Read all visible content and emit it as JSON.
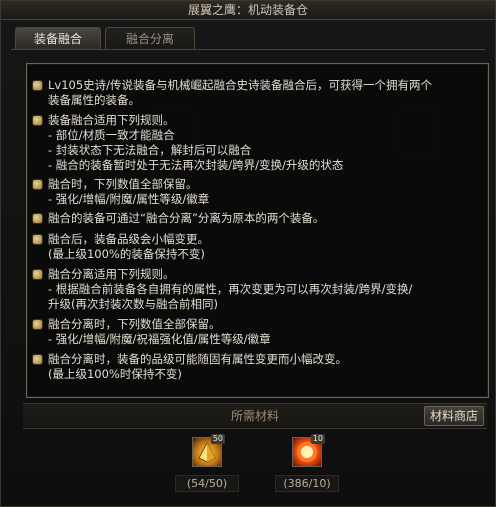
{
  "window": {
    "title": "展翼之鹰：机动装备仓"
  },
  "tabs": [
    {
      "label": "装备融合",
      "active": true
    },
    {
      "label": "融合分离",
      "active": false
    }
  ],
  "tooltip": {
    "items": [
      {
        "lines": [
          "Lv105史诗/传说装备与机械崛起融合史诗装备融合后，可获得一个拥有两个",
          "装备属性的装备。"
        ]
      },
      {
        "lines": [
          "装备融合适用下列规则。",
          "- 部位/材质一致才能融合",
          "- 封装状态下无法融合，解封后可以融合",
          "- 融合的装备暂时处于无法再次封装/跨界/变换/升级的状态"
        ]
      },
      {
        "lines": [
          "融合时，下列数值全部保留。",
          "- 强化/增幅/附魔/属性等级/徽章"
        ]
      },
      {
        "lines": [
          "融合的装备可通过“融合分离”分离为原本的两个装备。"
        ]
      },
      {
        "lines": [
          "融合后，装备品级会小幅变更。",
          "(最上级100%的装备保持不变)"
        ]
      },
      {
        "lines": [
          "融合分离适用下列规则。",
          "- 根据融合前装备各自拥有的属性，再次变更为可以再次封装/跨界/变换/",
          "升级(再次封装次数与融合前相同)"
        ]
      },
      {
        "lines": [
          "融合分离时，下列数值全部保留。",
          "- 强化/增幅/附魔/祝福强化值/属性等级/徽章"
        ]
      },
      {
        "lines": [
          "融合分离时，装备的品级可能随固有属性变更而小幅改变。",
          "(最上级100%时保持不变)"
        ]
      }
    ]
  },
  "materials": {
    "title": "所需材料",
    "shop_label": "材料商店",
    "list": [
      {
        "icon": "gold-material-icon",
        "badge": "50",
        "count": "(54/50)"
      },
      {
        "icon": "fire-orb-material-icon",
        "badge": "10",
        "count": "(386/10)"
      }
    ]
  }
}
